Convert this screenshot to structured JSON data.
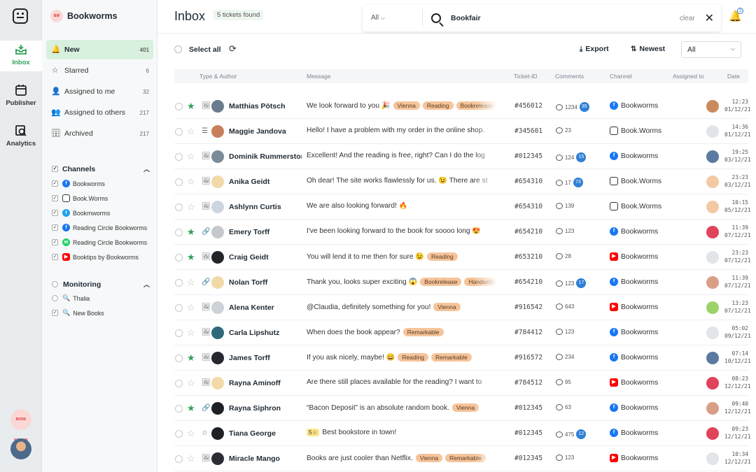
{
  "rail": {
    "items": [
      {
        "label": "Inbox",
        "icon": "inbox-icon"
      },
      {
        "label": "Publisher",
        "icon": "calendar-icon"
      },
      {
        "label": "Analytics",
        "icon": "analytics-icon"
      }
    ],
    "org_logo": "BOOK WORMS"
  },
  "sidebar": {
    "brand": "Bookworms",
    "nav": [
      {
        "label": "New",
        "count": "401",
        "icon": "🔔"
      },
      {
        "label": "Starred",
        "count": "6",
        "icon": "☆"
      },
      {
        "label": "Assigned to me",
        "count": "32",
        "icon": "👤"
      },
      {
        "label": "Assigned to others",
        "count": "217",
        "icon": "👥"
      },
      {
        "label": "Archived",
        "count": "217",
        "icon": "🗄"
      }
    ],
    "channels_title": "Channels",
    "channels": [
      {
        "label": "Bookworms",
        "type": "fb"
      },
      {
        "label": "Book.Worms",
        "type": "ig"
      },
      {
        "label": "Bookmworms",
        "type": "tw"
      },
      {
        "label": "Reading Circle Bookworms",
        "type": "fb"
      },
      {
        "label": "Reading Circle Bookworms",
        "type": "wa"
      },
      {
        "label": "Booktips by Bookworms",
        "type": "yt"
      }
    ],
    "monitoring_title": "Monitoring",
    "monitoring": [
      {
        "label": "Thalia",
        "checked": false
      },
      {
        "label": "New Books",
        "checked": true
      }
    ]
  },
  "header": {
    "title": "Inbox",
    "found": "5 tickets found",
    "search_scope": "All",
    "search_query": "Bookfair",
    "clear": "clear",
    "notifications": "3"
  },
  "toolbar": {
    "select_all": "Select all",
    "export": "Export",
    "sort": "Newest",
    "filter": "All"
  },
  "columns": [
    "Type & Author",
    "Message",
    "Ticket-ID",
    "Comments",
    "Channel",
    "Assigned to",
    "Date"
  ],
  "rows": [
    {
      "starred": true,
      "type": "🖼",
      "name": "Matthias Pötsch",
      "msg": "We look forward to you 🎉",
      "tags": [
        "Vienna",
        "Reading",
        "Bookrelease"
      ],
      "tid": "#456012",
      "comments": "1234",
      "badge": "35",
      "channel": "Bookworms",
      "ch": "fb",
      "time": "12:23",
      "date": "01/12/21",
      "av": "#6b7c8f",
      "asg": "#c98b5e"
    },
    {
      "starred": false,
      "type": "☰",
      "name": "Maggie Jandova",
      "msg": "Hello! I have a problem with my order in the online shop.",
      "tags": [],
      "tid": "#345601",
      "comments": "23",
      "badge": "",
      "channel": "Book.Worms",
      "ch": "ig",
      "time": "14:36",
      "date": "01/12/21",
      "av": "#c8805a",
      "asg": "#e1e4e8"
    },
    {
      "starred": false,
      "type": "🖼",
      "name": "Dominik Rummerstorfer",
      "msg": "Excellent! And the reading is free, right? Can I do the log",
      "tags": [],
      "tid": "#012345",
      "comments": "124",
      "badge": "15",
      "channel": "Bookworms",
      "ch": "fb",
      "time": "19:25",
      "date": "03/12/21",
      "av": "#7a8b99",
      "asg": "#5b7aa0"
    },
    {
      "starred": false,
      "type": "🖼",
      "name": "Anika Geidt",
      "msg": "Oh dear! The site works flawlessly for us. 😉 There are st",
      "tags": [],
      "tid": "#654310",
      "comments": "17",
      "badge": "73",
      "channel": "Book.Worms",
      "ch": "ig",
      "time": "23:23",
      "date": "03/12/21",
      "av": "#f2d9a8",
      "asg": "#f3c9a3"
    },
    {
      "starred": false,
      "type": "🖼",
      "name": "Ashlynn Curtis",
      "msg": "We are also looking forward! 🔥",
      "tags": [],
      "tid": "#654310",
      "comments": "139",
      "badge": "",
      "channel": "Book.Worms",
      "ch": "ig",
      "time": "10:15",
      "date": "05/12/21",
      "av": "#cdd6e0",
      "asg": "#f3c9a3"
    },
    {
      "starred": true,
      "type": "🔗",
      "name": "Emery Torff",
      "msg": "I've been looking forward to the book for soooo long 😍",
      "tags": [],
      "tid": "#654210",
      "comments": "123",
      "badge": "",
      "channel": "Bookworms",
      "ch": "fb",
      "time": "11:39",
      "date": "07/12/21",
      "av": "#c5c9ce",
      "asg": "#e0435a"
    },
    {
      "starred": true,
      "type": "🖼",
      "name": "Craig Geidt",
      "msg": "You will lend it to me then for sure 😉",
      "tags": [
        "Reading"
      ],
      "tid": "#653210",
      "comments": "28",
      "badge": "",
      "channel": "Bookworms",
      "ch": "yt",
      "time": "23:23",
      "date": "07/12/21",
      "av": "#22262b",
      "asg": "#e1e4e8"
    },
    {
      "starred": false,
      "type": "🔗",
      "name": "Nolan Torff",
      "msg": "Thank you, looks super exciting 😱",
      "tags": [
        "Bookrelease",
        "Handwriting"
      ],
      "tid": "#654210",
      "comments": "123",
      "badge": "17",
      "channel": "Bookworms",
      "ch": "fb",
      "time": "11:39",
      "date": "07/12/21",
      "av": "#f2d9a8",
      "asg": "#d89e86"
    },
    {
      "starred": false,
      "type": "🖼",
      "name": "Alena Kenter",
      "msg": "@Claudia, definitely something for you!",
      "tags": [
        "Vienna"
      ],
      "tid": "#916542",
      "comments": "643",
      "badge": "",
      "channel": "Bookworms",
      "ch": "yt",
      "time": "13:23",
      "date": "07/12/21",
      "av": "#cdd2d8",
      "asg": "#9bd36a"
    },
    {
      "starred": false,
      "type": "🖼",
      "name": "Carla Lipshutz",
      "msg": "When does the book appear?",
      "tags": [
        "Remarkable"
      ],
      "tid": "#784412",
      "comments": "123",
      "badge": "",
      "channel": "Bookworms",
      "ch": "fb",
      "time": "05:02",
      "date": "09/12/21",
      "av": "#2e6a7a",
      "asg": "#e1e4e8"
    },
    {
      "starred": true,
      "type": "🖼",
      "name": "James Torff",
      "msg": "If you ask nicely, maybe! 😄",
      "tags": [
        "Reading",
        "Remarkable"
      ],
      "tid": "#916572",
      "comments": "234",
      "badge": "",
      "channel": "Bookworms",
      "ch": "fb",
      "time": "07:14",
      "date": "10/12/21",
      "av": "#25292e",
      "asg": "#5b7aa0"
    },
    {
      "starred": false,
      "type": "🖼",
      "name": "Rayna Aminoff",
      "msg": "Are there still places available for the reading? I want to",
      "tags": [],
      "tid": "#784512",
      "comments": "95",
      "badge": "",
      "channel": "Bookworms",
      "ch": "yt",
      "time": "08:23",
      "date": "12/12/21",
      "av": "#f2d9a8",
      "asg": "#e0435a"
    },
    {
      "starred": true,
      "type": "🔗",
      "name": "Rayna Siphron",
      "msg": "“Bacon Deposit” is an absolute random book.",
      "tags": [
        "Vienna"
      ],
      "tid": "#012345",
      "comments": "63",
      "badge": "",
      "channel": "Bookworms",
      "ch": "fb",
      "time": "09:40",
      "date": "12/12/21",
      "av": "#1e2226",
      "asg": "#d89e86"
    },
    {
      "starred": false,
      "type": "☆",
      "name": "Tiana George",
      "msg": "Best bookstore in town!",
      "emoji": "5☆",
      "tags": [],
      "tid": "#012345",
      "comments": "475",
      "badge": "12",
      "channel": "Bookworms",
      "ch": "fb",
      "time": "09:23",
      "date": "12/12/21",
      "av": "#1e2226",
      "asg": "#e0435a"
    },
    {
      "starred": false,
      "type": "🖼",
      "name": "Miracle Mango",
      "msg": "Books are just cooler than Netflix.",
      "tags": [
        "Vienna",
        "Remarkable"
      ],
      "tid": "#012345",
      "comments": "123",
      "badge": "",
      "channel": "Bookworms",
      "ch": "yt",
      "time": "10:34",
      "date": "12/12/21",
      "av": "#2a2e33",
      "asg": "#e1e4e8"
    }
  ]
}
